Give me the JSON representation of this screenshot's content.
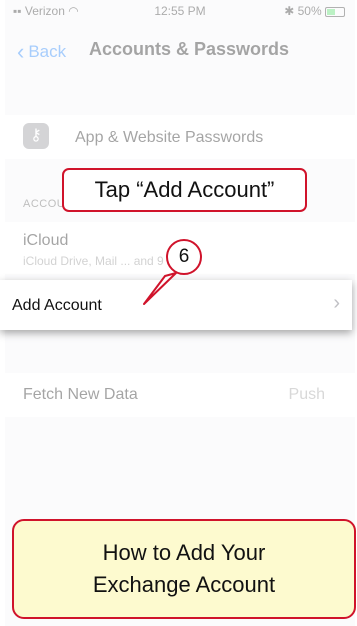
{
  "status_bar": {
    "carrier": "Verizon",
    "time": "12:55 PM",
    "battery": "50%"
  },
  "nav": {
    "back_label": "Back",
    "title": "Accounts & Passwords"
  },
  "passwords_row": {
    "label": "App & Website Passwords"
  },
  "accounts_section": {
    "header": "ACCOUNTS",
    "icloud": {
      "label": "iCloud",
      "subtitle": "iCloud Drive, Mail ... and 9 more"
    },
    "add_account": {
      "label": "Add Account"
    }
  },
  "fetch_row": {
    "label": "Fetch New Data",
    "value": "Push"
  },
  "annotations": {
    "tap_callout": "Tap “Add Account”",
    "step_number": "6",
    "title_line1": "How to Add Your",
    "title_line2": "Exchange Account",
    "accent_color": "#d0132b",
    "note_background": "#fdfacf"
  }
}
